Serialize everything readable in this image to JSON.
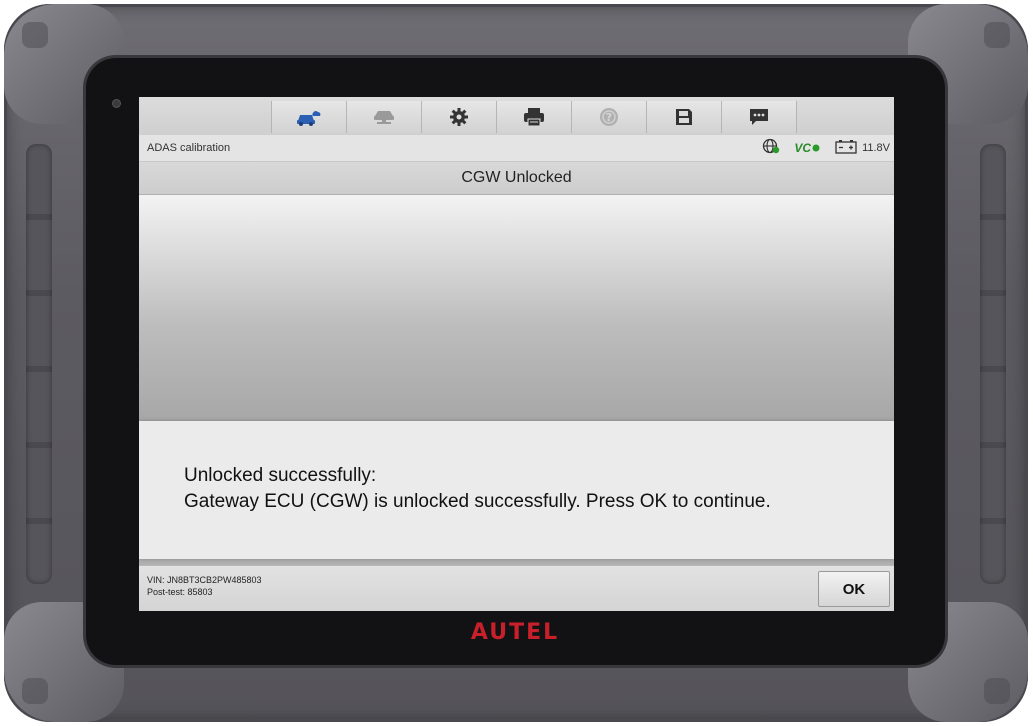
{
  "device": {
    "brand": "AUTEL",
    "brand_color": "#c8202a"
  },
  "toolbar": {
    "items": [
      {
        "icon": "vehicle-cloud-icon",
        "color": "#2a5fb3"
      },
      {
        "icon": "vehicle-lift-icon",
        "color": "#9a9a9a"
      },
      {
        "icon": "gear-icon",
        "color": "#333333"
      },
      {
        "icon": "printer-icon",
        "color": "#333333"
      },
      {
        "icon": "help-icon",
        "color": "#9a9a9a"
      },
      {
        "icon": "save-icon",
        "color": "#333333"
      },
      {
        "icon": "message-icon",
        "color": "#333333"
      }
    ]
  },
  "status_bar": {
    "section": "ADAS calibration",
    "vci_label": "VC",
    "battery_voltage": "11.8V"
  },
  "page": {
    "title": "CGW Unlocked"
  },
  "dialog": {
    "line1": "Unlocked successfully:",
    "line2": "Gateway ECU (CGW) is unlocked successfully. Press OK to continue."
  },
  "footer": {
    "vin": "VIN: JN8BT3CB2PW485803",
    "post_test": "Post-test: 85803",
    "ok_label": "OK"
  }
}
